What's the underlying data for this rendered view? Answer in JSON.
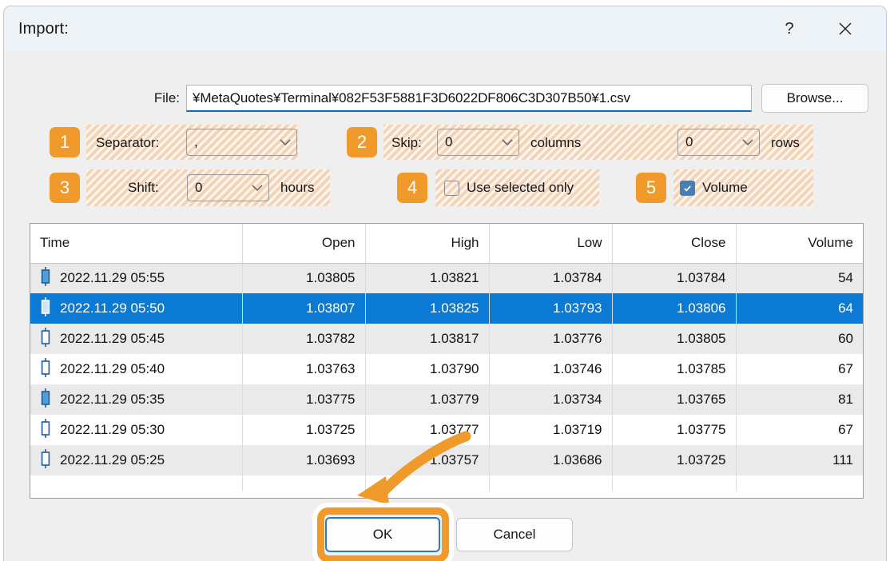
{
  "window": {
    "title": "Import:",
    "help_icon": "question-mark-icon",
    "close_icon": "close-icon"
  },
  "file_row": {
    "label": "File:",
    "value": "¥MetaQuotes¥Terminal¥082F53F5881F3D6022DF806C3D307B50¥1.csv",
    "placeholder": "",
    "browse_label": "Browse..."
  },
  "options": {
    "badge_1": "1",
    "badge_2": "2",
    "badge_3": "3",
    "badge_4": "4",
    "badge_5": "5",
    "separator_label": "Separator:",
    "separator_value": ",",
    "skip_label": "Skip:",
    "skip_columns_value": "0",
    "skip_columns_suffix": "columns",
    "skip_rows_value": "0",
    "skip_rows_suffix": "rows",
    "shift_label": "Shift:",
    "shift_value": "0",
    "shift_suffix": "hours",
    "use_selected_only_label": "Use selected only",
    "use_selected_only_checked": false,
    "volume_label": "Volume",
    "volume_checked": true
  },
  "table": {
    "columns": [
      "Time",
      "Open",
      "High",
      "Low",
      "Close",
      "Volume"
    ],
    "rows": [
      {
        "candle": "filled",
        "time": "2022.11.29 05:55",
        "open": "1.03805",
        "high": "1.03821",
        "low": "1.03784",
        "close": "1.03784",
        "volume": "54",
        "selected": false
      },
      {
        "candle": "filled",
        "time": "2022.11.29 05:50",
        "open": "1.03807",
        "high": "1.03825",
        "low": "1.03793",
        "close": "1.03806",
        "volume": "64",
        "selected": true
      },
      {
        "candle": "hollow",
        "time": "2022.11.29 05:45",
        "open": "1.03782",
        "high": "1.03817",
        "low": "1.03776",
        "close": "1.03805",
        "volume": "60",
        "selected": false
      },
      {
        "candle": "hollow",
        "time": "2022.11.29 05:40",
        "open": "1.03763",
        "high": "1.03790",
        "low": "1.03746",
        "close": "1.03785",
        "volume": "67",
        "selected": false
      },
      {
        "candle": "filled",
        "time": "2022.11.29 05:35",
        "open": "1.03775",
        "high": "1.03779",
        "low": "1.03734",
        "close": "1.03765",
        "volume": "81",
        "selected": false
      },
      {
        "candle": "hollow",
        "time": "2022.11.29 05:30",
        "open": "1.03725",
        "high": "1.03777",
        "low": "1.03719",
        "close": "1.03775",
        "volume": "67",
        "selected": false
      },
      {
        "candle": "hollow",
        "time": "2022.11.29 05:25",
        "open": "1.03693",
        "high": "1.03757",
        "low": "1.03686",
        "close": "1.03725",
        "volume": "111",
        "selected": false
      }
    ]
  },
  "footer": {
    "ok_label": "OK",
    "cancel_label": "Cancel"
  },
  "colors": {
    "badge_orange": "#f09a2c",
    "highlight_peach": "#f7dfc8",
    "selection_blue": "#0b7ad4",
    "focus_blue": "#2a7cc7",
    "titlebar": "#edf3f6",
    "dialog_body": "#efefef"
  }
}
